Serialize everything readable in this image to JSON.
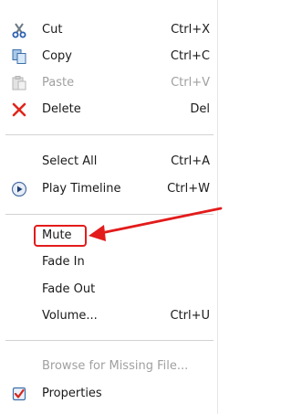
{
  "menu": {
    "items": [
      {
        "label": "Cut",
        "shortcut": "Ctrl+X",
        "icon": "scissors-icon"
      },
      {
        "label": "Copy",
        "shortcut": "Ctrl+C",
        "icon": "copy-icon"
      },
      {
        "label": "Paste",
        "shortcut": "Ctrl+V",
        "icon": "paste-icon",
        "disabled": true
      },
      {
        "label": "Delete",
        "shortcut": "Del",
        "icon": "delete-icon"
      },
      {
        "label": "Select All",
        "shortcut": "Ctrl+A"
      },
      {
        "label": "Play Timeline",
        "shortcut": "Ctrl+W",
        "icon": "play-icon"
      },
      {
        "label": "Mute",
        "shortcut": "",
        "highlighted": true
      },
      {
        "label": "Fade In",
        "shortcut": ""
      },
      {
        "label": "Fade Out",
        "shortcut": ""
      },
      {
        "label": "Volume...",
        "shortcut": "Ctrl+U"
      },
      {
        "label": "Browse for Missing File...",
        "shortcut": "",
        "disabled": true
      },
      {
        "label": "Properties",
        "shortcut": "",
        "icon": "properties-icon"
      }
    ]
  },
  "colors": {
    "annotation": "#e31b1b",
    "disabled_text": "#a0a0a0",
    "separator": "#d2d2d2"
  }
}
